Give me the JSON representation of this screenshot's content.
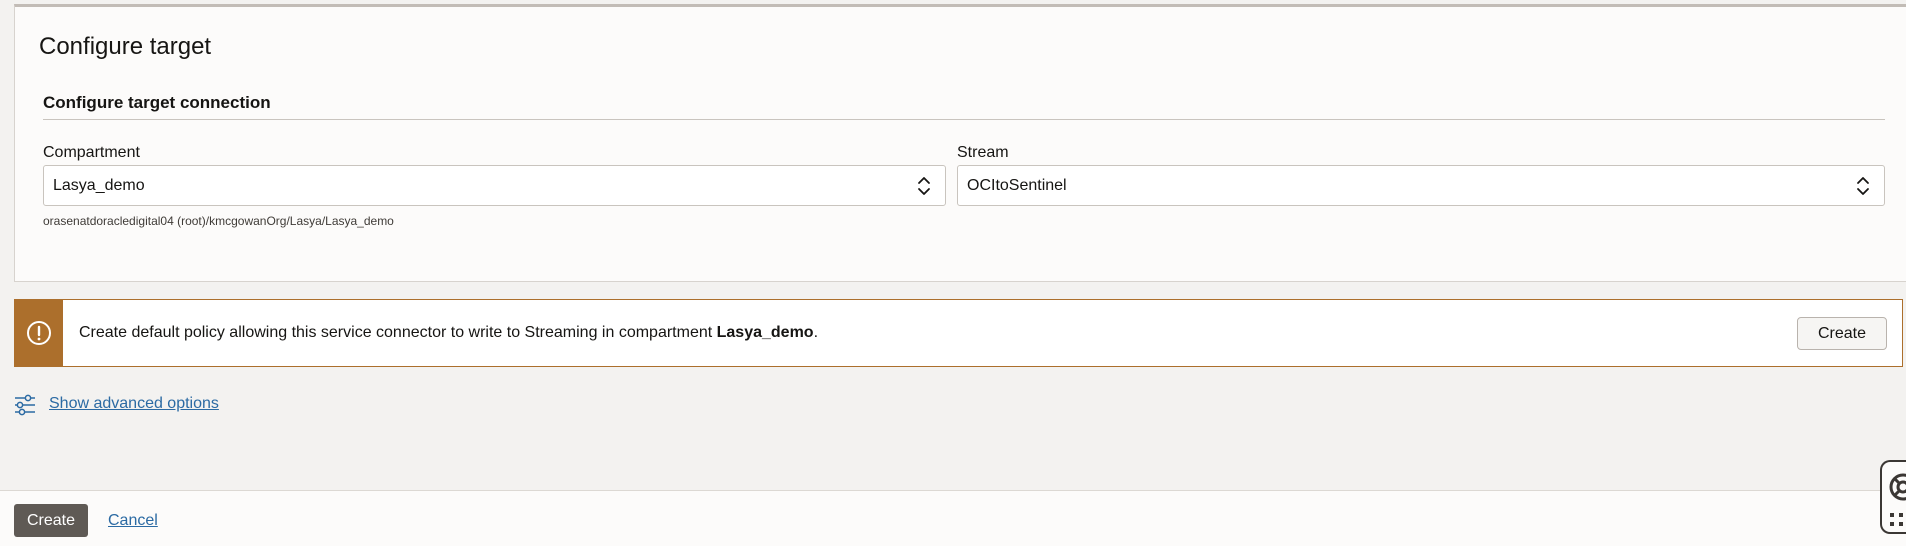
{
  "panel": {
    "title": "Configure target",
    "section_title": "Configure target connection",
    "compartment": {
      "label": "Compartment",
      "value": "Lasya_demo",
      "path_hint": "orasenatdoracledigital04 (root)/kmcgowanOrg/Lasya/Lasya_demo"
    },
    "stream": {
      "label": "Stream",
      "value": "OCItoSentinel"
    }
  },
  "notice": {
    "text_before": "Create default policy allowing this service connector to write to Streaming in compartment ",
    "text_bold": "Lasya_demo",
    "text_after": ".",
    "button_label": "Create",
    "accent_color": "#ac6f2c"
  },
  "advanced": {
    "link_label": "Show advanced options",
    "icon": "sliders-icon"
  },
  "footer": {
    "create_label": "Create",
    "cancel_label": "Cancel"
  },
  "colors": {
    "link": "#2b6aa3",
    "primary_button": "#5f5a55",
    "page_background": "#f3f2f0"
  }
}
